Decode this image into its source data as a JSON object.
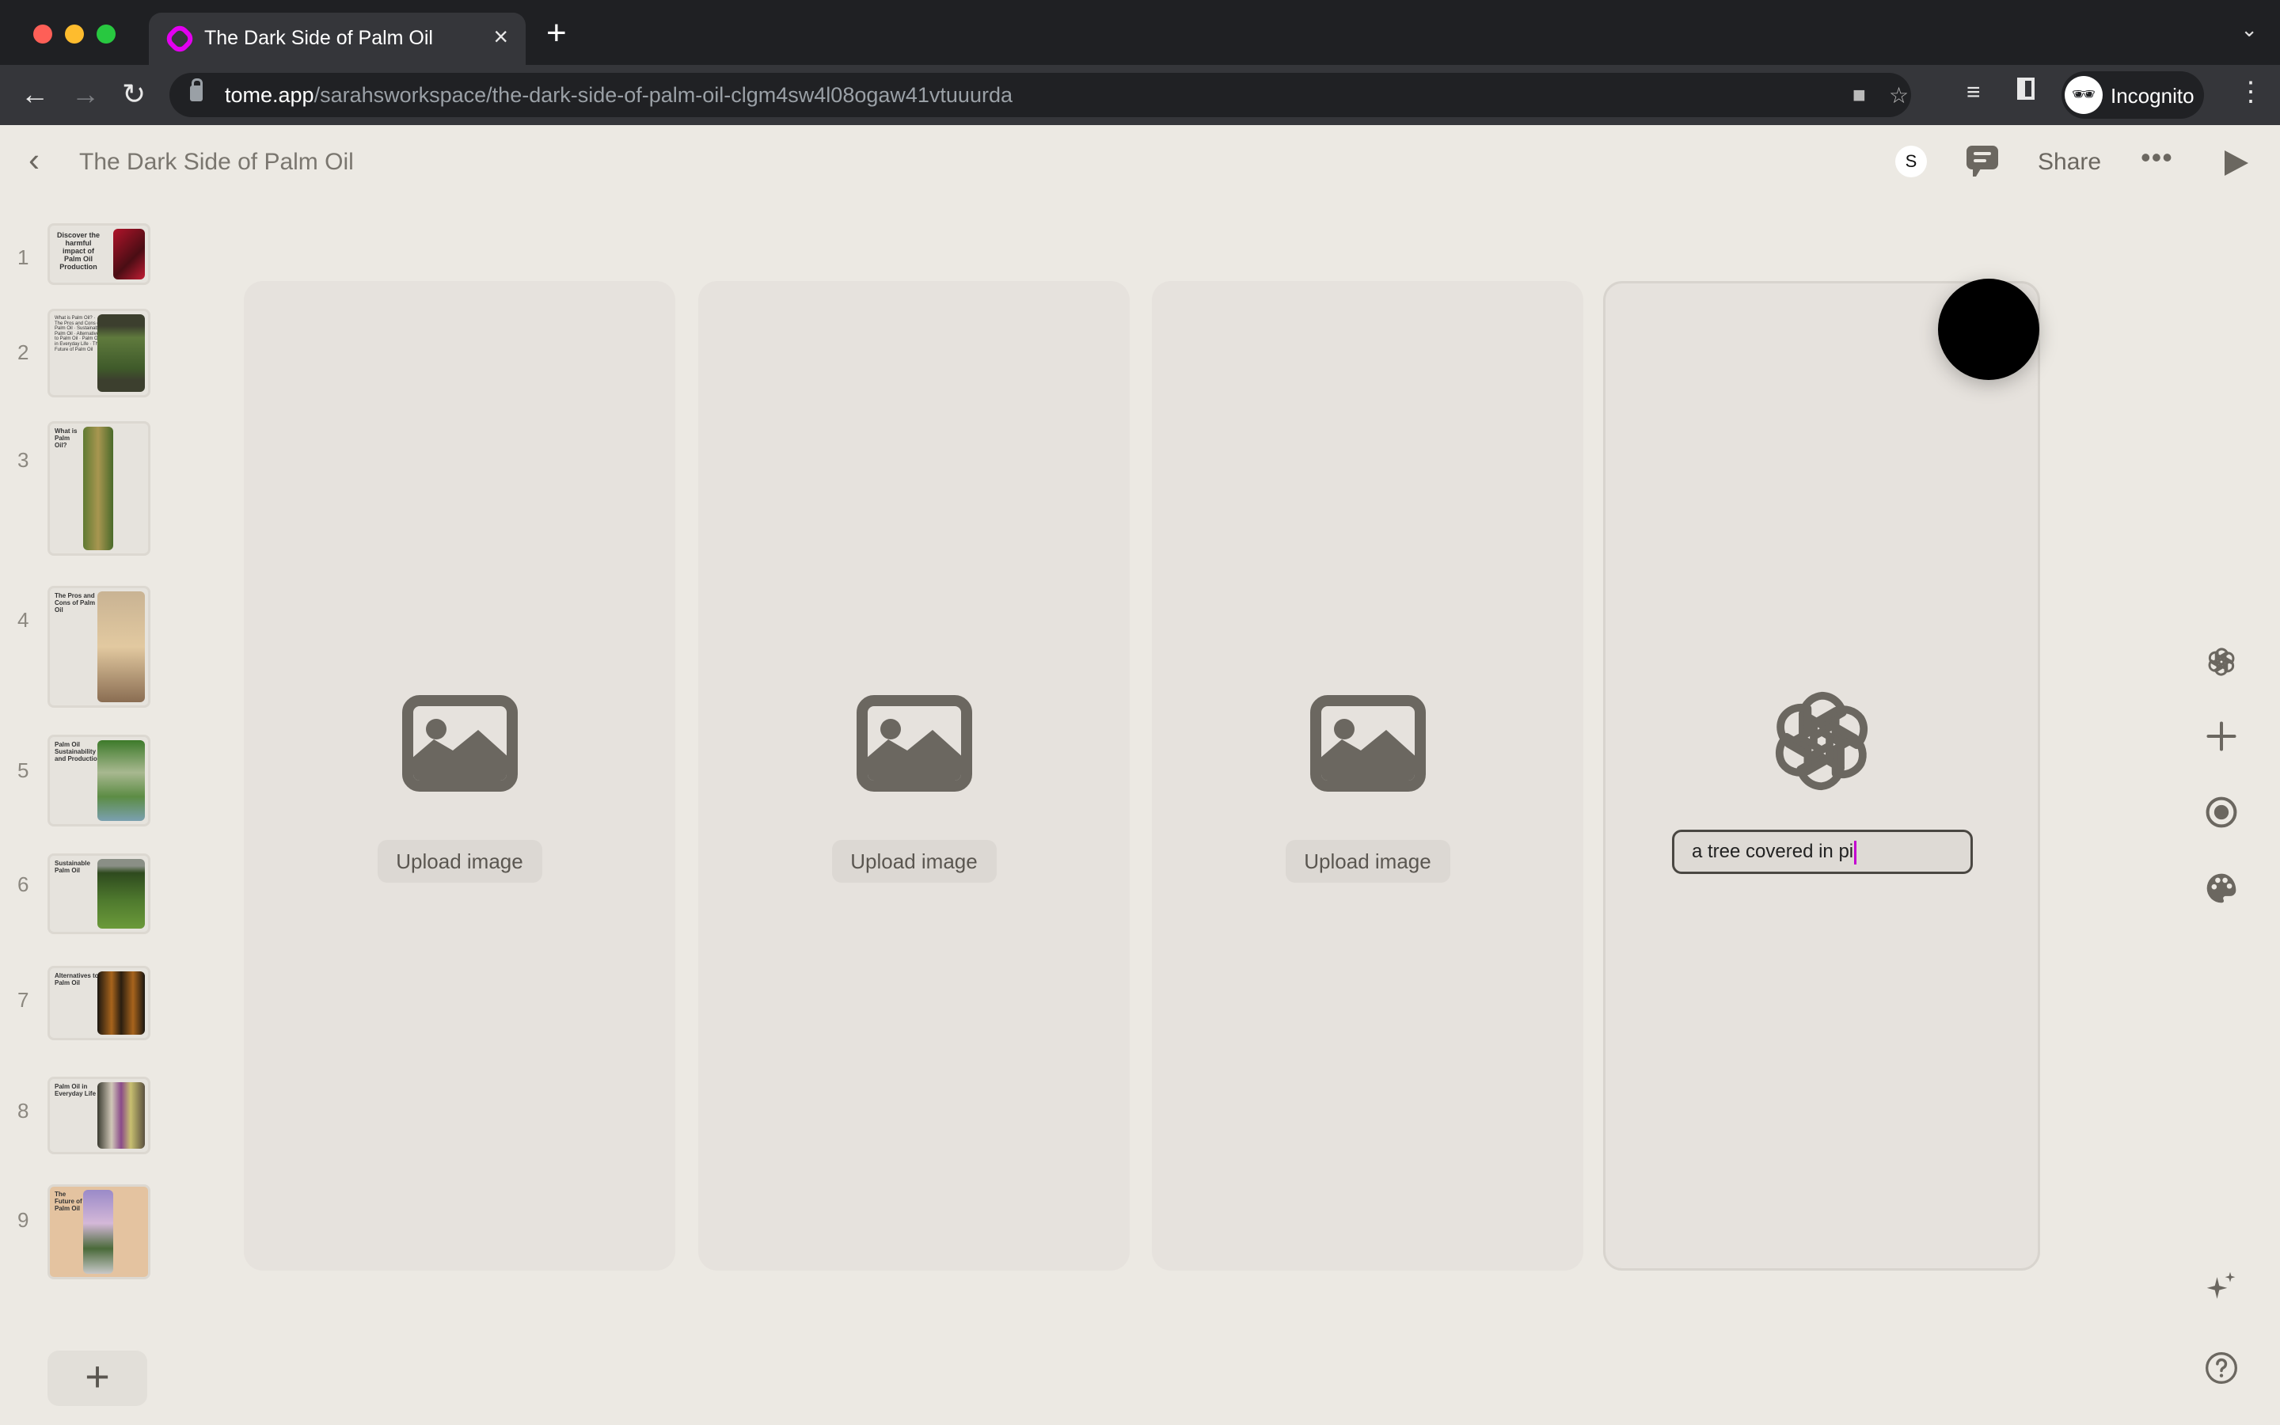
{
  "browser": {
    "tab_title": "The Dark Side of Palm Oil",
    "tab_close": "×",
    "new_tab": "+",
    "url_host": "tome.app",
    "url_path": "/sarahsworkspace/the-dark-side-of-palm-oil-clgm4sw4l08ogaw41vtuuurda",
    "incognito_label": "Incognito",
    "favicon_color": "#e300f0"
  },
  "header": {
    "title": "The Dark Side of Palm Oil",
    "avatar_initial": "S",
    "share_label": "Share"
  },
  "slides": [
    {
      "number": "1",
      "title": "Discover the harmful impact of Palm Oil Production",
      "image": "red flowers"
    },
    {
      "number": "2",
      "title": "What is Palm Oil? · The Pros and Cons of Palm Oil · Sustainable Palm Oil · Alternatives to Palm Oil · Palm Oil in Everyday Life · The Future of Palm Oil",
      "image": "forest"
    },
    {
      "number": "3",
      "title": "What is Palm Oil?",
      "image": "jungle tree"
    },
    {
      "number": "4",
      "title": "The Pros and Cons of Palm Oil",
      "image": "hazy landscape"
    },
    {
      "number": "5",
      "title": "Palm Oil Sustainability and Production",
      "image": "jungle river"
    },
    {
      "number": "6",
      "title": "Sustainable Palm Oil",
      "image": "palm plantation"
    },
    {
      "number": "7",
      "title": "Alternatives to Palm Oil",
      "image": "oil bottles"
    },
    {
      "number": "8",
      "title": "Palm Oil in Everyday Life",
      "image": "jars on shelf"
    },
    {
      "number": "9",
      "title": "The Future of Palm Oil",
      "image": "futuristic city"
    }
  ],
  "add_slide": "+",
  "canvas": {
    "panels": [
      {
        "type": "upload",
        "button": "Upload image"
      },
      {
        "type": "upload",
        "button": "Upload image"
      },
      {
        "type": "upload",
        "button": "Upload image"
      },
      {
        "type": "ai-generate",
        "prompt_value": "a tree covered in pi"
      }
    ]
  },
  "right_rail": [
    "openai-icon",
    "plus-icon",
    "record-icon",
    "palette-icon",
    "sparkle-icon",
    "help-icon"
  ]
}
